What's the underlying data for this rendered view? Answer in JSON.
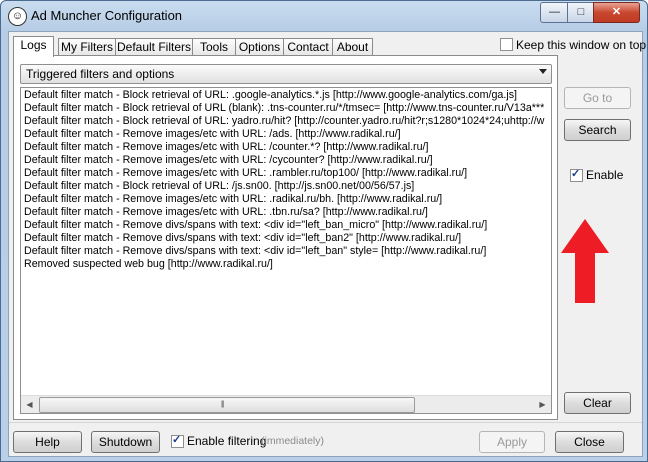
{
  "window": {
    "title": "Ad Muncher Configuration",
    "app_icon": "ad-muncher-icon"
  },
  "controls": {
    "minimize": "—",
    "maximize": "□",
    "close": "✕"
  },
  "tabs": [
    {
      "label": "Logs",
      "active": true
    },
    {
      "label": "My Filters"
    },
    {
      "label": "Default Filters"
    },
    {
      "label": "Tools"
    },
    {
      "label": "Options"
    },
    {
      "label": "Contact"
    },
    {
      "label": "About"
    }
  ],
  "keep_on_top": {
    "label": "Keep this window on top",
    "checked": false
  },
  "log_filter": {
    "selected": "Triggered filters and options"
  },
  "log_lines": [
    "Default filter match - Block retrieval of URL: .google-analytics.*.js [http://www.google-analytics.com/ga.js]",
    "Default filter match - Block retrieval of URL (blank): .tns-counter.ru/*/tmsec= [http://www.tns-counter.ru/V13a***",
    "Default filter match - Block retrieval of URL: yadro.ru/hit? [http://counter.yadro.ru/hit?r;s1280*1024*24;uhttp://w",
    "Default filter match - Remove images/etc with URL: /ads. [http://www.radikal.ru/]",
    "Default filter match - Remove images/etc with URL: /counter.*? [http://www.radikal.ru/]",
    "Default filter match - Remove images/etc with URL: /cycounter? [http://www.radikal.ru/]",
    "Default filter match - Remove images/etc with URL: .rambler.ru/top100/ [http://www.radikal.ru/]",
    "Default filter match - Block retrieval of URL: /js.sn00. [http://js.sn00.net/00/56/57.js]",
    "Default filter match - Remove images/etc with URL: .radikal.ru/bh. [http://www.radikal.ru/]",
    "Default filter match - Remove images/etc with URL: .tbn.ru/sa? [http://www.radikal.ru/]",
    "Default filter match - Remove divs/spans with text: <div id=\"left_ban_micro\" [http://www.radikal.ru/]",
    "Default filter match - Remove divs/spans with text: <div id=\"left_ban2\" [http://www.radikal.ru/]",
    "Default filter match - Remove divs/spans with text: <div id=\"left_ban\" style= [http://www.radikal.ru/]",
    "Removed suspected web bug [http://www.radikal.ru/]"
  ],
  "scrollbar": {
    "left_arrow": "◀",
    "right_arrow": "▶",
    "grip": "|||"
  },
  "side": {
    "goto_label": "Go to",
    "search_label": "Search",
    "enable_label": "Enable",
    "enable_checked": true,
    "clear_label": "Clear"
  },
  "footer": {
    "help_label": "Help",
    "shutdown_label": "Shutdown",
    "enable_filtering_label": "Enable filtering",
    "enable_filtering_checked": true,
    "immediately_note": "(immediately)",
    "apply_label": "Apply",
    "close_label": "Close"
  },
  "colors": {
    "accent_arrow": "#ee1c25",
    "title_bar": "#b9d0e8"
  }
}
